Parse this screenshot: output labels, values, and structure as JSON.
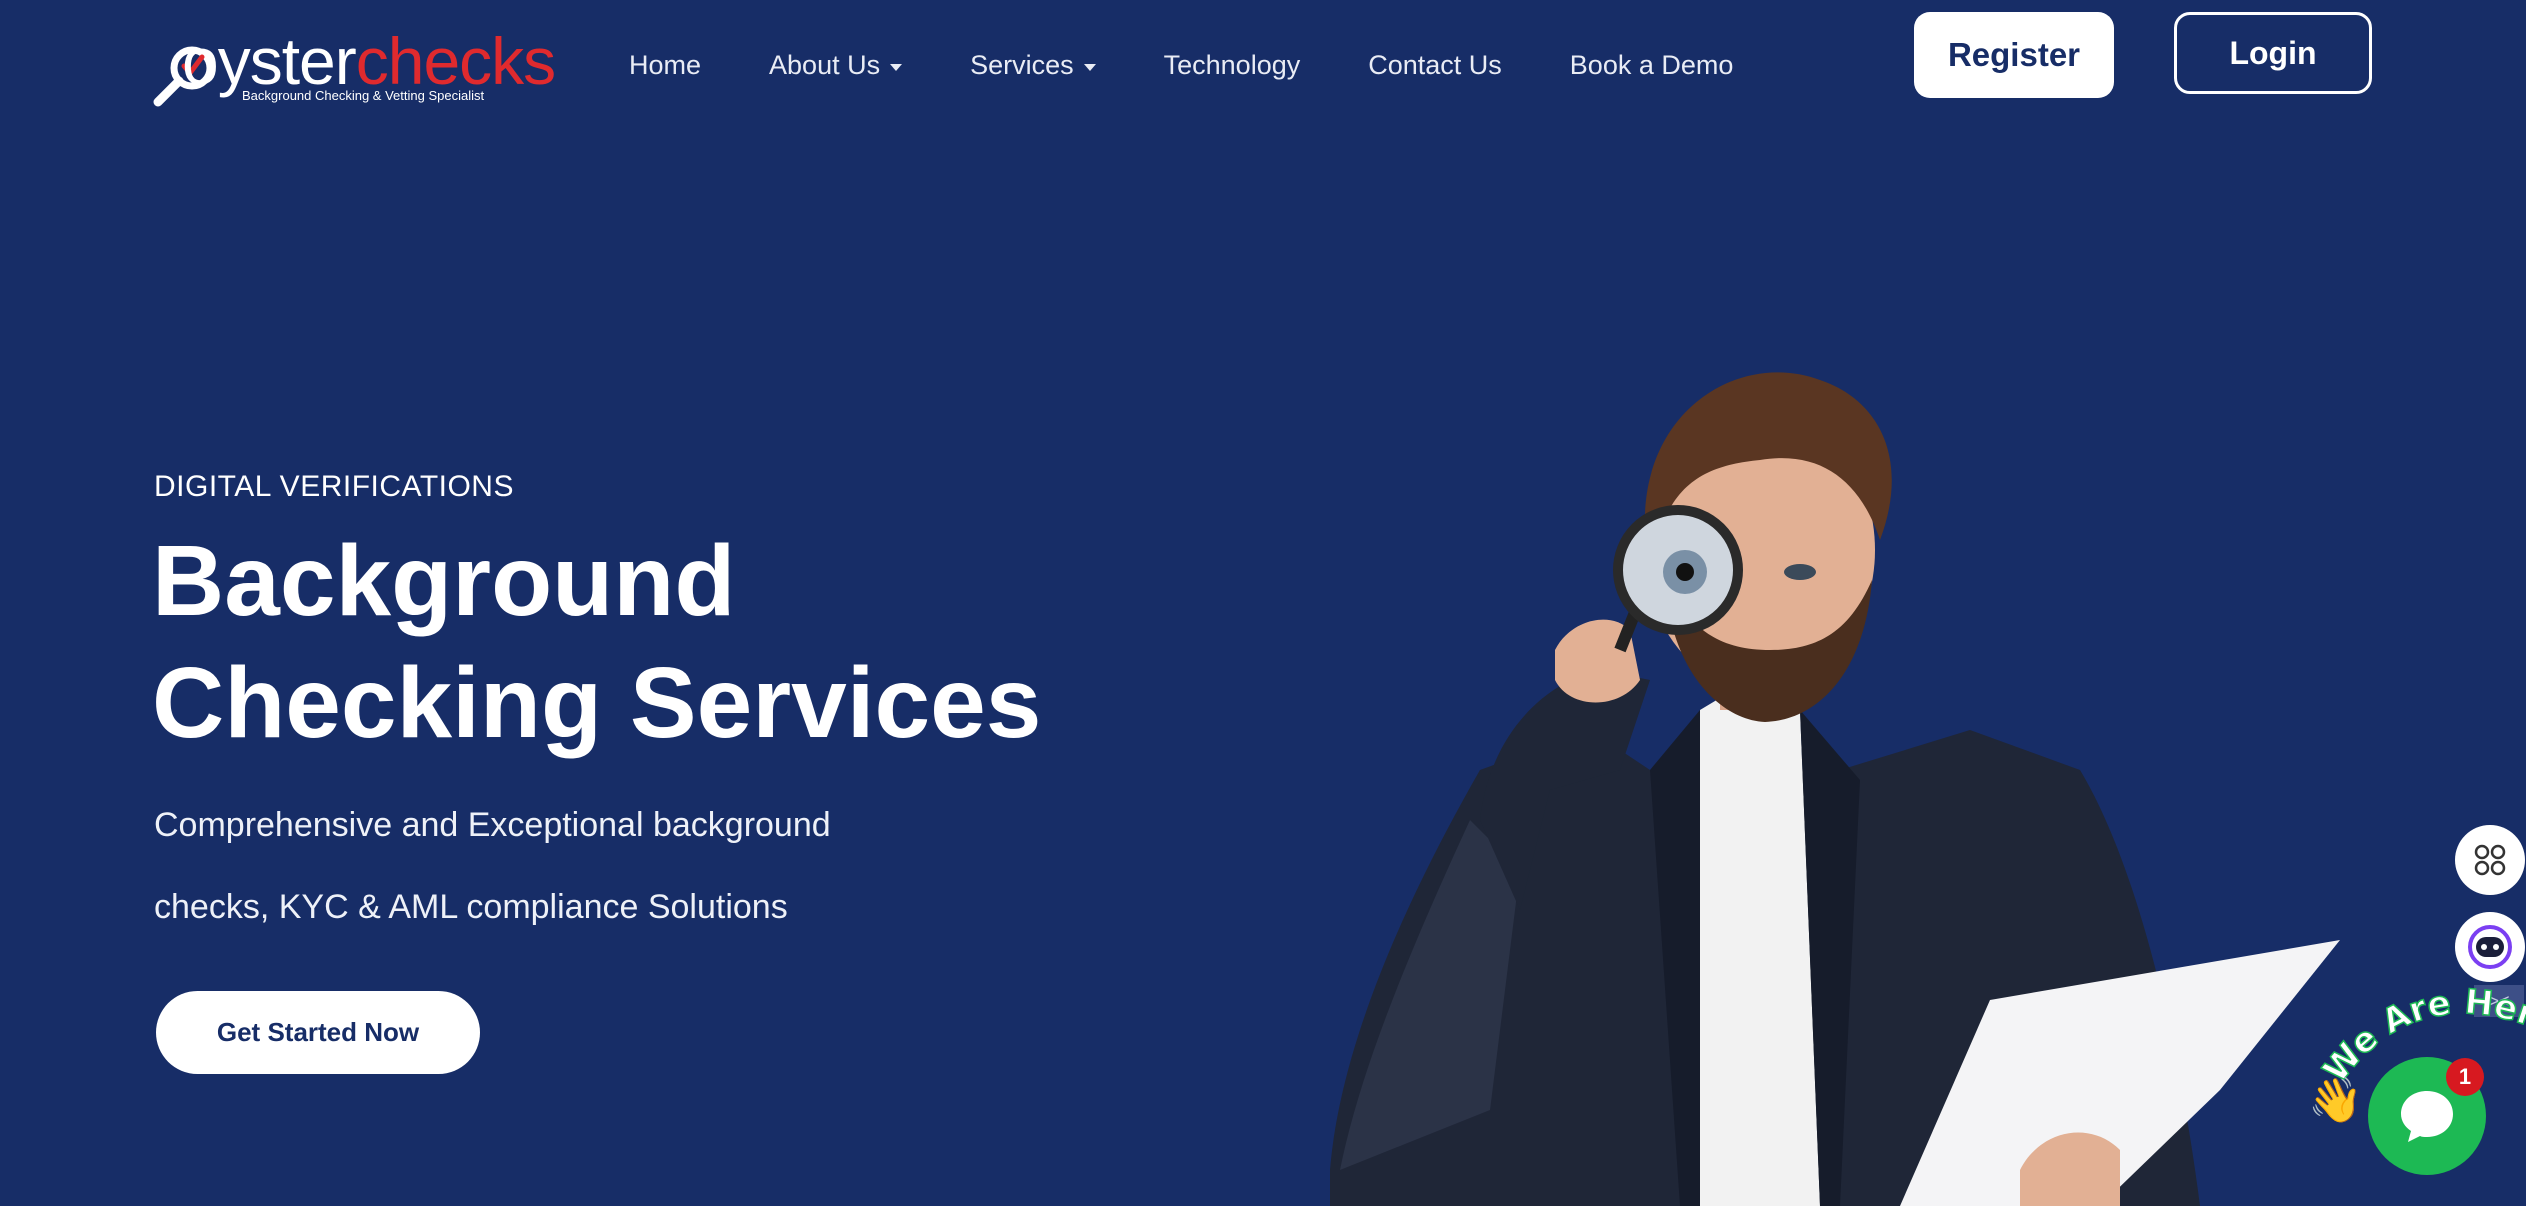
{
  "brand": {
    "name_part1": "oyster",
    "name_part2": "checks",
    "tagline": "Background Checking & Vetting Specialist",
    "colors": {
      "background": "#172d67",
      "accent_red": "#e02a2e",
      "chat_green": "#1db954"
    }
  },
  "nav": {
    "items": [
      {
        "label": "Home",
        "has_dropdown": false
      },
      {
        "label": "About Us",
        "has_dropdown": true
      },
      {
        "label": "Services",
        "has_dropdown": true
      },
      {
        "label": "Technology",
        "has_dropdown": false
      },
      {
        "label": "Contact Us",
        "has_dropdown": false
      },
      {
        "label": "Book a Demo",
        "has_dropdown": false
      }
    ],
    "register_label": "Register",
    "login_label": "Login"
  },
  "hero": {
    "eyebrow": "DIGITAL VERIFICATIONS",
    "title_line1": "Background",
    "title_line2": "Checking Services",
    "subtitle_line1": "Comprehensive and Exceptional background",
    "subtitle_line2": "checks, KYC & AML compliance Solutions",
    "cta_label": "Get Started Now",
    "image_icon": "man-with-magnifying-glass-image"
  },
  "widgets": {
    "apps_icon": "apps-grid-icon",
    "assistant_icon": "bot-face-icon",
    "close_label": "><",
    "chat_wave_text": "We Are Here!",
    "chat_badge_count": "1",
    "chat_icon": "chat-bubble-icon"
  }
}
